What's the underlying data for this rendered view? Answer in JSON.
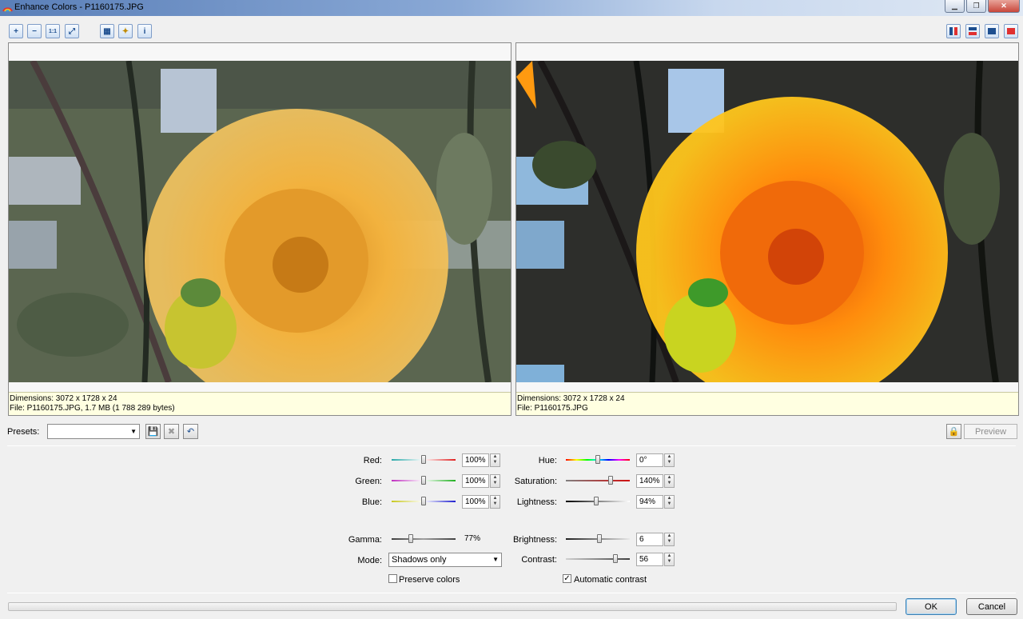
{
  "window": {
    "title": "Enhance Colors - P1160175.JPG"
  },
  "toolbar_left": [
    {
      "name": "zoom-in-icon",
      "glyph": "+"
    },
    {
      "name": "zoom-out-icon",
      "glyph": "−"
    },
    {
      "name": "actual-size-icon",
      "glyph": "1:1"
    },
    {
      "name": "fit-to-window-icon",
      "glyph": "⤢"
    },
    {
      "name": "image-view-icon",
      "glyph": "▦"
    },
    {
      "name": "highlight-icon",
      "glyph": "✦"
    },
    {
      "name": "info-icon",
      "glyph": "i"
    }
  ],
  "left_panel": {
    "dimensions": "Dimensions: 3072 x 1728 x 24",
    "file": "File: P1160175.JPG, 1.7 MB (1 788 289 bytes)"
  },
  "right_panel": {
    "dimensions": "Dimensions: 3072 x 1728 x 24",
    "file": "File: P1160175.JPG"
  },
  "presets": {
    "label": "Presets:",
    "value": ""
  },
  "preview_label": "Preview",
  "adjust_left": [
    {
      "label": "Red:",
      "value": "100%",
      "level": 0.5,
      "gradient": "linear-gradient(90deg,#2aa8a8,#ffffff,#e02020)"
    },
    {
      "label": "Green:",
      "value": "100%",
      "level": 0.5,
      "gradient": "linear-gradient(90deg,#c030c0,#ffffff,#20b020)"
    },
    {
      "label": "Blue:",
      "value": "100%",
      "level": 0.5,
      "gradient": "linear-gradient(90deg,#c8c820,#ffffff,#2020d0)"
    }
  ],
  "adjust_right": [
    {
      "label": "Hue:",
      "value": "0°",
      "level": 0.5,
      "gradient": "linear-gradient(90deg,#ff0000,#ffff00,#00ff00,#00ffff,#0000ff,#ff00ff,#ff0000)"
    },
    {
      "label": "Saturation:",
      "value": "140%",
      "level": 0.7,
      "gradient": "linear-gradient(90deg,#808080,#d01010)"
    },
    {
      "label": "Lightness:",
      "value": "94%",
      "level": 0.47,
      "gradient": "linear-gradient(90deg,#000000,#ffffff)"
    }
  ],
  "gamma": {
    "label": "Gamma:",
    "value": "77%",
    "level": 0.3
  },
  "brightness": {
    "label": "Brightness:",
    "value": "6",
    "level": 0.53
  },
  "contrast": {
    "label": "Contrast:",
    "value": "56",
    "level": 0.78
  },
  "mode": {
    "label": "Mode:",
    "value": "Shadows only"
  },
  "preserve_colors": {
    "label": "Preserve colors",
    "checked": false
  },
  "automatic_contrast": {
    "label": "Automatic contrast",
    "checked": true
  },
  "buttons": {
    "ok": "OK",
    "cancel": "Cancel"
  },
  "colors": {
    "accent": "#3c7fb1",
    "info_bg": "#ffffe1"
  }
}
